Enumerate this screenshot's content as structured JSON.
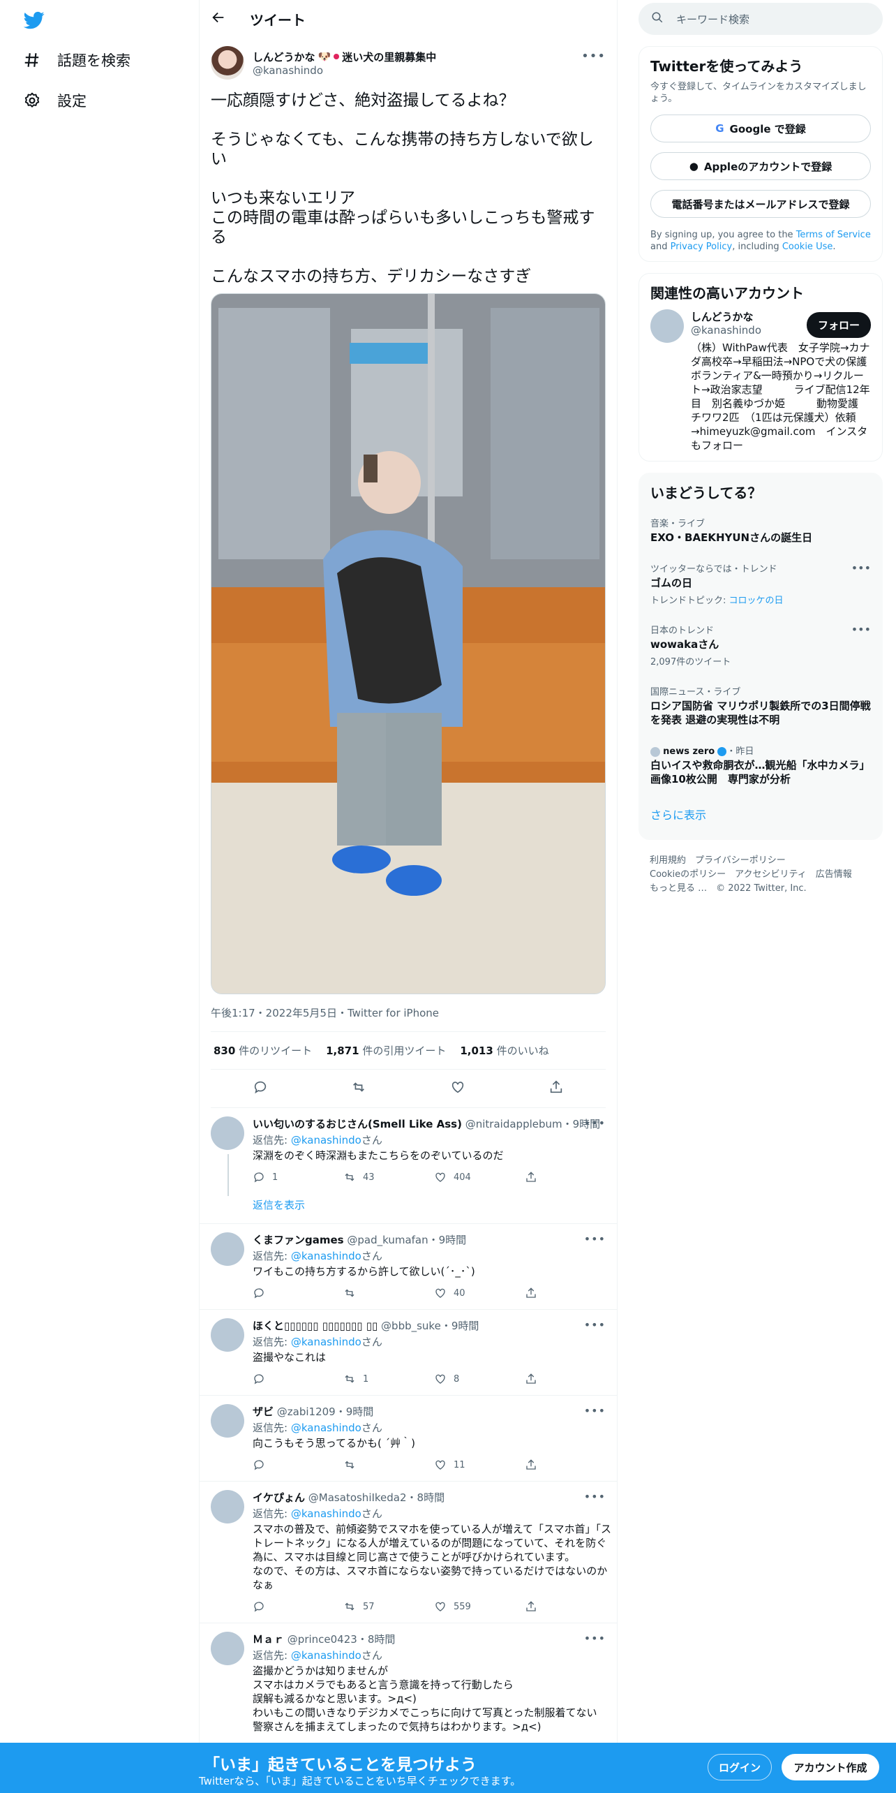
{
  "nav": {
    "explore_label": "話題を検索",
    "settings_label": "設定"
  },
  "header": {
    "title": "ツイート"
  },
  "tweet": {
    "author_name": "しんどうかな",
    "author_status": "迷い犬の里親募集中",
    "author_handle": "@kanashindo",
    "text": "一応顔隠すけどさ、絶対盗撮してるよね？\n\nそうじゃなくても、こんな携帯の持ち方しないで欲しい\n\nいつも来ないエリア\nこの時間の電車は酔っぱらいも多いしこっちも警戒する\n\nこんなスマホの持ち方、デリカシーなさすぎ",
    "timestamp": "午後1:17・2022年5月5日・Twitter for iPhone",
    "retweets_count": "830",
    "retweets_label": "件のリツイート",
    "quotes_count": "1,871",
    "quotes_label": "件の引用ツイート",
    "likes_count": "1,013",
    "likes_label": "件のいいね"
  },
  "replies": [
    {
      "name": "いい匂いのするおじさん(Smell Like Ass)",
      "handle": "@nitraidapplebum",
      "time": "・9時間",
      "replying_prefix": "返信先: ",
      "replying_to": "@kanashindo",
      "replying_suffix": "さん",
      "text": "深淵をのぞく時深淵もまたこちらをのぞいているのだ",
      "replies": "1",
      "retweets": "43",
      "likes": "404",
      "show_replies": "返信を表示"
    },
    {
      "name": "くまファンgames",
      "handle": "@pad_kumafan",
      "time": "・9時間",
      "replying_prefix": "返信先: ",
      "replying_to": "@kanashindo",
      "replying_suffix": "さん",
      "text": "ワイもこの持ち方するから許して欲しい(´･_･`)",
      "replies": "",
      "retweets": "",
      "likes": "40"
    },
    {
      "name": "ほくと▯▯▯▯▯▯ ▯▯▯▯▯▯▯ ▯▯",
      "handle": "@bbb_suke",
      "time": "・9時間",
      "replying_prefix": "返信先: ",
      "replying_to": "@kanashindo",
      "replying_suffix": "さん",
      "text": "盗撮やなこれは",
      "replies": "",
      "retweets": "1",
      "likes": "8"
    },
    {
      "name": "ザビ",
      "handle": "@zabi1209",
      "time": "・9時間",
      "replying_prefix": "返信先: ",
      "replying_to": "@kanashindo",
      "replying_suffix": "さん",
      "text": "向こうもそう思ってるかも( ´艸｀)",
      "replies": "",
      "retweets": "",
      "likes": "11"
    },
    {
      "name": "イケぴょん",
      "handle": "@MasatoshiIkeda2",
      "time": "・8時間",
      "replying_prefix": "返信先: ",
      "replying_to": "@kanashindo",
      "replying_suffix": "さん",
      "text": "スマホの普及で、前傾姿勢でスマホを使っている人が増えて「スマホ首」「ストレートネック」になる人が増えているのが問題になっていて、それを防ぐ為に、スマホは目線と同じ高さで使うことが呼びかけられています。\nなので、その方は、スマホ首にならない姿勢で持っているだけではないのかなぁ",
      "replies": "",
      "retweets": "57",
      "likes": "559"
    },
    {
      "name": "Ｍａｒ",
      "handle": "@prince0423",
      "time": "・8時間",
      "replying_prefix": "返信先: ",
      "replying_to": "@kanashindo",
      "replying_suffix": "さん",
      "text": "盗撮かどうかは知りませんが\nスマホはカメラでもあると言う意識を持って行動したら\n誤解も減るかなと思います。>д<)\nわいもこの間いきなりデジカメでこっちに向けて写真とった制服着てない\n警察さんを捕まえてしまったので気持ちはわかります。>д<)"
    }
  ],
  "search": {
    "placeholder": "キーワード検索"
  },
  "signup_card": {
    "title": "Twitterを使ってみよう",
    "subtitle": "今すぐ登録して、タイムラインをカスタマイズしましょう。",
    "google_label": "Google で登録",
    "apple_label": "Appleのアカウントで登録",
    "phone_label": "電話番号またはメールアドレスで登録",
    "legal_prefix": "By signing up, you agree to the ",
    "terms_label": "Terms of Service",
    "legal_and": " and ",
    "privacy_label": "Privacy Policy",
    "legal_including": ", including ",
    "cookie_label": "Cookie Use",
    "legal_end": "."
  },
  "related": {
    "title": "関連性の高いアカウント",
    "name": "しんどうかな",
    "handle": "@kanashindo",
    "follow_label": "フォロー",
    "bio": "（株）WithPaw代表　女子学院→カナダ高校卒→早稲田法→NPOで犬の保護ボランティア&一時預かり→リクルート→政治家志望　　　ライブ配信12年目　別名義ゆづか姫　　　動物愛護　チワワ2匹　（1匹は元保護犬）依頼→himeyuzk@gmail.com　インスタもフォロー"
  },
  "trends": {
    "title": "いまどうしてる？",
    "items": [
      {
        "meta": "音楽・ライブ",
        "name": "EXO・BAEKHYUNさんの誕生日",
        "sub": ""
      },
      {
        "meta": "ツイッターならでは・トレンド",
        "name": "ゴムの日",
        "sub_prefix": "トレンドトピック: ",
        "sub_link": "コロッケの日"
      },
      {
        "meta": "日本のトレンド",
        "name": "wowakaさん",
        "sub": "2,097件のツイート"
      },
      {
        "meta": "国際ニュース・ライブ",
        "name": "ロシア国防省 マリウポリ製鉄所での3日間停戦を発表 退避の実現性は不明",
        "sub": ""
      },
      {
        "meta_source": "news zero",
        "meta_time": "・昨日",
        "name": "白いイスや救命胴衣が…観光船「水中カメラ」画像10枚公開　専門家が分析",
        "sub": ""
      }
    ],
    "show_more": "さらに表示"
  },
  "footer": {
    "terms": "利用規約",
    "privacy": "プライバシーポリシー",
    "cookie": "Cookieのポリシー",
    "accessibility": "アクセシビリティ",
    "ads": "広告情報",
    "more": "もっと見る …",
    "copyright": "© 2022 Twitter, Inc."
  },
  "banner": {
    "title": "「いま」起きていることを見つけよう",
    "subtitle": "Twitterなら、「いま」起きていることをいち早くチェックできます。",
    "login_label": "ログイン",
    "signup_label": "アカウント作成"
  },
  "colors": {
    "accent": "#1d9bf0",
    "text": "#0f1419",
    "secondary": "#536471"
  }
}
